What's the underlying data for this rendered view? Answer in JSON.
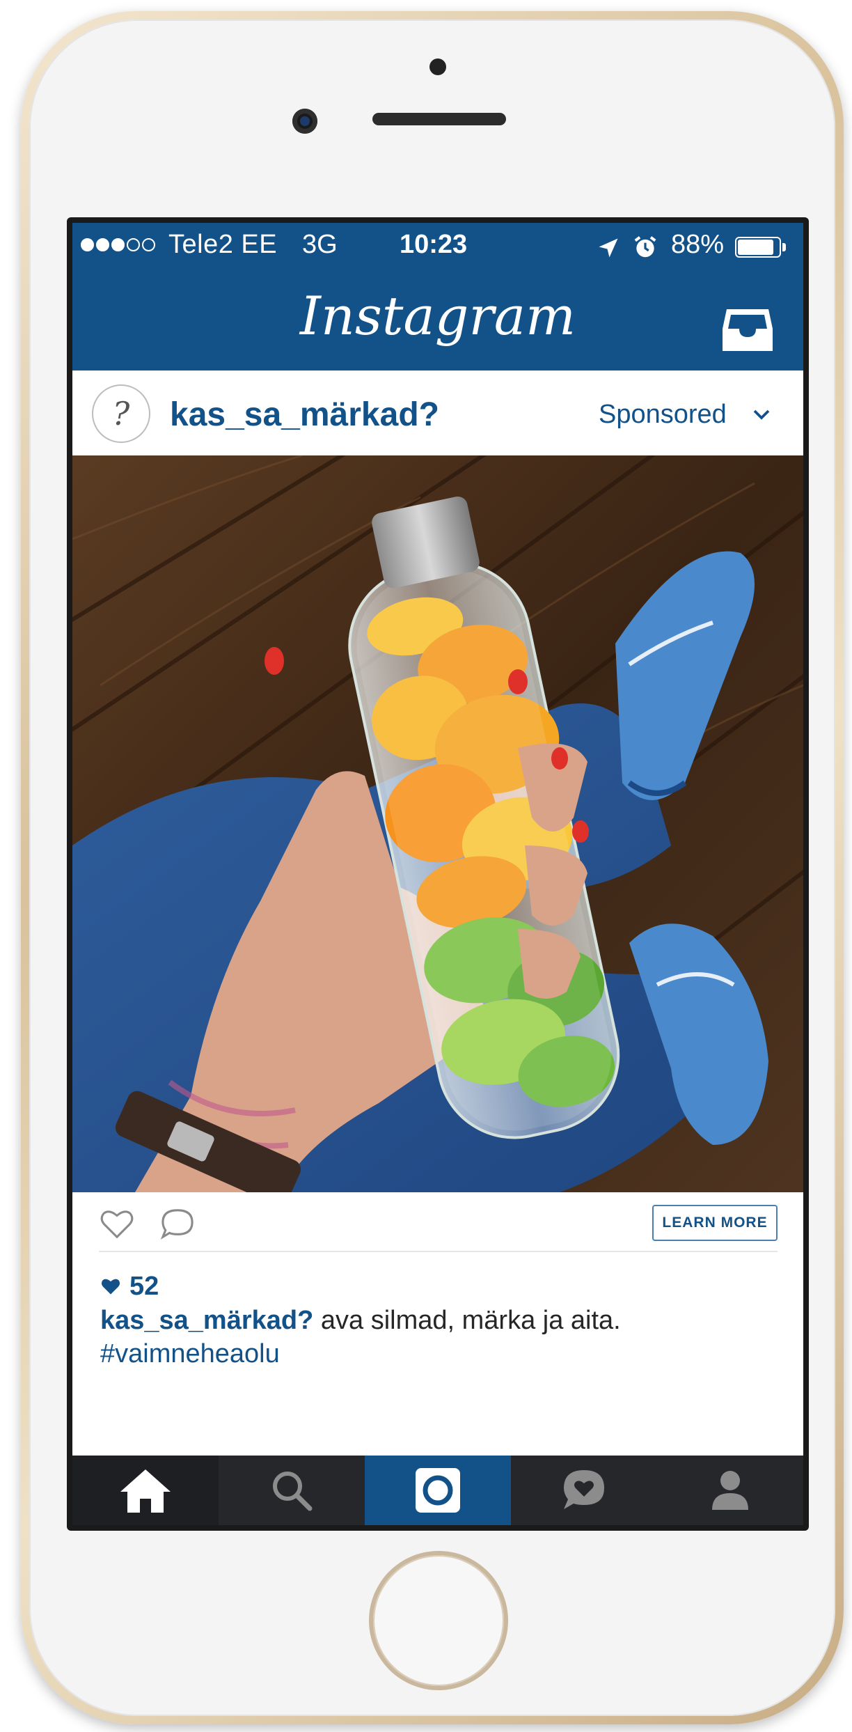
{
  "status_bar": {
    "carrier": "Tele2 EE",
    "network": "3G",
    "time": "10:23",
    "battery": "88%",
    "battery_level": 0.88,
    "signal_bars_filled": 3,
    "signal_bars_total": 5,
    "icons": [
      "location-arrow-icon",
      "alarm-clock-icon",
      "battery-icon"
    ]
  },
  "header": {
    "app_name": "Instagram",
    "right_icon": "inbox-icon",
    "color": "#135289"
  },
  "post": {
    "avatar_glyph": "?",
    "username": "kas_sa_märkad?",
    "sponsored_label": "Sponsored",
    "photo_subject": "hand holding a glass water bottle with orange and lime slices, legs in jeans and blue boat shoes on a wooden floor",
    "learn_more_label": "LEARN MORE",
    "likes": "52",
    "caption_username": "kas_sa_märkad?",
    "caption_text": " ava silmad, märka ja aita.",
    "hashtag": "#vaimneheaolu"
  },
  "tab_bar": {
    "items": [
      {
        "name": "home",
        "icon": "home-icon",
        "active": true
      },
      {
        "name": "search",
        "icon": "search-icon",
        "active": false
      },
      {
        "name": "camera",
        "icon": "camera-icon",
        "active": false
      },
      {
        "name": "activity",
        "icon": "activity-heart-icon",
        "active": false
      },
      {
        "name": "profile",
        "icon": "profile-icon",
        "active": false
      }
    ]
  },
  "colors": {
    "brand_blue": "#135289",
    "tab_bar_bg": "#26272b",
    "phone_frame": "#d9c29c"
  }
}
